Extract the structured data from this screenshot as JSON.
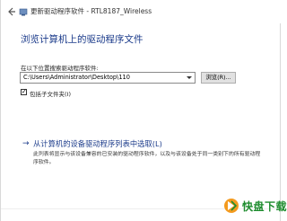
{
  "titlebar": {
    "title": "更新驱动程序软件 - RTL8187_Wireless",
    "back_icon": "back-arrow-icon",
    "app_icon": "device-icon"
  },
  "heading": "浏览计算机上的驱动程序文件",
  "search": {
    "label": "在以下位置搜索驱动程序软件:",
    "path_value": "C:\\Users\\Administrator\\Desktop\\110",
    "browse_label": "浏览(R)..."
  },
  "include_subfolders": {
    "label": "包括子文件夹(I)",
    "checked": true
  },
  "pick_option": {
    "title": "从计算机的设备驱动程序列表中选取(L)",
    "description": "此列表将显示与该设备兼容的已安装的驱动程序软件，以及与该设备处于同一类别下的所有驱动程序软件。"
  },
  "watermark": {
    "text": "快盘下载",
    "colors": {
      "green": "#1e8c2e",
      "orange": "#f39a1e"
    }
  }
}
